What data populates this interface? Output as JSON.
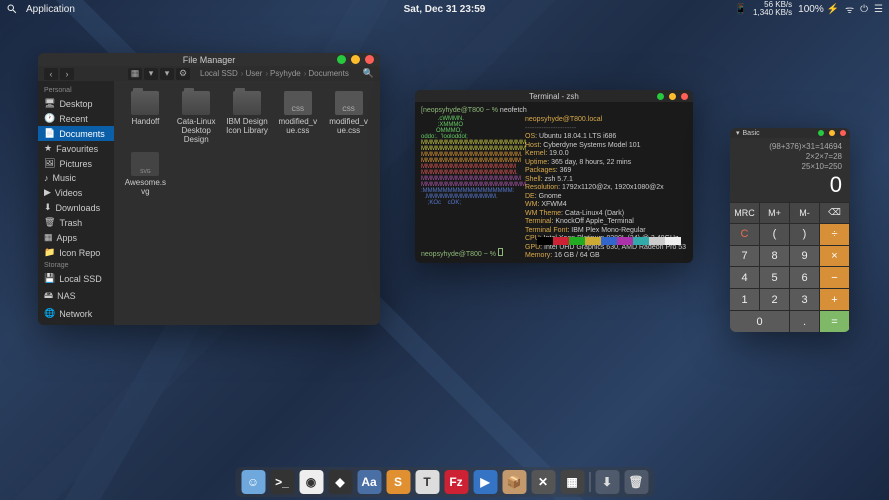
{
  "topbar": {
    "app_label": "Application",
    "datetime": "Sat, Dec 31  23:59",
    "net": {
      "down": "56 KB/s",
      "up": "1,340 KB/s"
    },
    "battery": "100%"
  },
  "fm": {
    "title": "File Manager",
    "breadcrumbs": [
      "Local SSD",
      "User",
      "Psyhyde",
      "Documents"
    ],
    "sidebar": {
      "sections": [
        {
          "label": "Personal",
          "items": [
            {
              "label": "Desktop",
              "icon": "desktop-icon"
            },
            {
              "label": "Recent",
              "icon": "clock-icon"
            },
            {
              "label": "Documents",
              "icon": "documents-icon",
              "active": true
            },
            {
              "label": "Favourites",
              "icon": "star-icon"
            },
            {
              "label": "Pictures",
              "icon": "pictures-icon"
            },
            {
              "label": "Music",
              "icon": "music-icon"
            },
            {
              "label": "Videos",
              "icon": "videos-icon"
            },
            {
              "label": "Downloads",
              "icon": "downloads-icon"
            },
            {
              "label": "Trash",
              "icon": "trash-icon"
            },
            {
              "label": "Apps",
              "icon": "apps-icon"
            },
            {
              "label": "Icon Repo",
              "icon": "folder-icon"
            }
          ]
        },
        {
          "label": "Storage",
          "items": [
            {
              "label": "Local SSD",
              "icon": "drive-icon"
            },
            {
              "label": "NAS",
              "icon": "nas-icon"
            },
            {
              "label": "Network",
              "icon": "network-icon"
            }
          ]
        }
      ]
    },
    "files": [
      {
        "name": "Handoff",
        "type": "folder"
      },
      {
        "name": "Cata-Linux Desktop Design",
        "type": "folder"
      },
      {
        "name": "IBM Design Icon Library",
        "type": "folder"
      },
      {
        "name": "modified_vue.css",
        "type": "css"
      },
      {
        "name": "modified_vue.css",
        "type": "css"
      },
      {
        "name": "Awesome.svg",
        "type": "svg"
      }
    ]
  },
  "term": {
    "title": "Terminal - zsh",
    "prompt_user": "[neopsyhyde@T800 ~ %",
    "command": "neofetch",
    "header": "neopsyhyde@T800.local",
    "info": [
      {
        "k": "OS",
        "v": "Ubuntu 18.04.1 LTS i686"
      },
      {
        "k": "Host",
        "v": "Cyberdyne Systems Model 101"
      },
      {
        "k": "Kernel",
        "v": "19.0.0"
      },
      {
        "k": "Uptime",
        "v": "365 day, 8 hours, 22 mins"
      },
      {
        "k": "Packages",
        "v": "369"
      },
      {
        "k": "Shell",
        "v": "zsh 5.7.1"
      },
      {
        "k": "Resolution",
        "v": "1792x1120@2x, 1920x1080@2x"
      },
      {
        "k": "DE",
        "v": "Gnome"
      },
      {
        "k": "WM",
        "v": "XFWM4"
      },
      {
        "k": "WM Theme",
        "v": "Cata-Linux4 (Dark)"
      },
      {
        "k": "Terminal",
        "v": "KnockOff Apple_Terminal"
      },
      {
        "k": "Terminal Font",
        "v": "IBM Plex Mono-Regular"
      },
      {
        "k": "CPU",
        "v": "Intel Xeon Platinum 8280L (24) @ 3.40GHz"
      },
      {
        "k": "GPU",
        "v": "Intel UHD Graphics 630, AMD Radeon Pro 53"
      },
      {
        "k": "Memory",
        "v": "16 GB / 64 GB"
      }
    ],
    "colors": [
      "#000",
      "#c23",
      "#2a2",
      "#ca3",
      "#36c",
      "#a3a",
      "#3aa",
      "#ccc",
      "#eee"
    ]
  },
  "calc": {
    "title": "Basic",
    "history": [
      "(98+376)×31=14694",
      "2×2×7=28",
      "25×10=250"
    ],
    "result": "0",
    "keys": {
      "mrc": "MRC",
      "mplus": "M+",
      "mminus": "M-",
      "back": "⌫",
      "c": "C",
      "lp": "(",
      "rp": ")",
      "div": "÷",
      "k7": "7",
      "k8": "8",
      "k9": "9",
      "mul": "×",
      "k4": "4",
      "k5": "5",
      "k6": "6",
      "sub": "−",
      "k1": "1",
      "k2": "2",
      "k3": "3",
      "add": "+",
      "k0": "0",
      "dot": ".",
      "eq": "="
    }
  },
  "dock": {
    "items": [
      {
        "name": "finder",
        "bg": "#6fa8dc",
        "txt": "☺"
      },
      {
        "name": "terminal",
        "bg": "#333",
        "txt": ">_"
      },
      {
        "name": "chrome",
        "bg": "#eee",
        "txt": "◉"
      },
      {
        "name": "sketch",
        "bg": "#333",
        "txt": "◆"
      },
      {
        "name": "fonts",
        "bg": "#4a6fa5",
        "txt": "Aa"
      },
      {
        "name": "sublime",
        "bg": "#e09030",
        "txt": "S"
      },
      {
        "name": "text",
        "bg": "#ddd",
        "txt": "T"
      },
      {
        "name": "filezilla",
        "bg": "#c23",
        "txt": "Fz"
      },
      {
        "name": "video",
        "bg": "#3573c4",
        "txt": "▶"
      },
      {
        "name": "archive",
        "bg": "#c49a6c",
        "txt": "📦"
      },
      {
        "name": "remove",
        "bg": "#555",
        "txt": "✕"
      },
      {
        "name": "calculator",
        "bg": "#444",
        "txt": "▦"
      }
    ],
    "tray": [
      {
        "name": "downloads",
        "txt": "⬇"
      },
      {
        "name": "trash",
        "txt": "🗑"
      }
    ]
  }
}
